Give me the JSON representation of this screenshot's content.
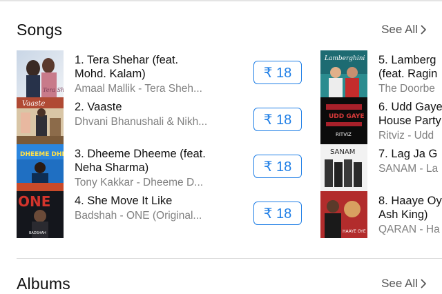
{
  "songs_section": {
    "title": "Songs",
    "see_all": "See All"
  },
  "albums_section": {
    "title": "Albums",
    "see_all": "See All"
  },
  "songs": [
    {
      "title_line1": "1. Tera Shehar (feat.",
      "title_line2": "Mohd. Kalam)",
      "subtitle": "Amaal Mallik - Tera Sheh...",
      "price": "₹ 18"
    },
    {
      "title_line1": "2. Vaaste",
      "title_line2": "",
      "subtitle": "Dhvani Bhanushali & Nikh...",
      "price": "₹ 18"
    },
    {
      "title_line1": "3. Dheeme Dheeme (feat.",
      "title_line2": "Neha Sharma)",
      "subtitle": "Tony Kakkar - Dheeme D...",
      "price": "₹ 18"
    },
    {
      "title_line1": "4. She Move It Like",
      "title_line2": "",
      "subtitle": "Badshah - ONE (Original...",
      "price": "₹ 18"
    },
    {
      "title_line1": "5. Lamberg",
      "title_line2": "(feat. Ragin",
      "subtitle": "The Doorbe"
    },
    {
      "title_line1": "6. Udd Gaye",
      "title_line2": "House Party",
      "subtitle": "Ritviz - Udd"
    },
    {
      "title_line1": "7. Lag Ja G",
      "title_line2": "",
      "subtitle": "SANAM - La"
    },
    {
      "title_line1": "8. Haaye Oy",
      "title_line2": "Ash King)",
      "subtitle": "QARAN - Ha"
    }
  ],
  "artwork_text": {
    "song1": "Tera Shehar",
    "song2": "Vaaste",
    "song3": "DHEEME DHEEME",
    "song4": "ONE",
    "song4_small": "BADSHAH",
    "song5": "Lamberghini",
    "song6": "UDD GAYE",
    "song6_small": "RITVIZ",
    "song7": "SANAM",
    "song8": "HAAYE OYE"
  },
  "colors": {
    "accent": "#1e7ee6",
    "secondary_text": "#808080"
  },
  "icons": {
    "see_all_chevron": "chevron-right-icon"
  }
}
